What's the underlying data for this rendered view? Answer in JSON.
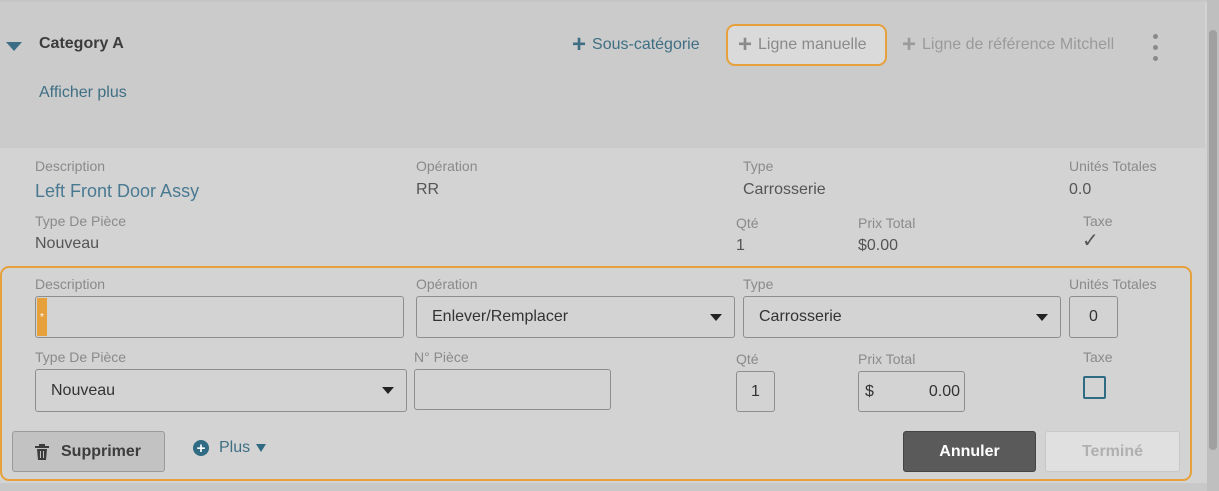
{
  "category": {
    "title": "Category A",
    "show_more": "Afficher plus",
    "actions": {
      "subcategory": "Sous-catégorie",
      "manual_line": "Ligne manuelle",
      "mitchell_line": "Ligne de référence Mitchell"
    }
  },
  "item": {
    "labels": {
      "description": "Description",
      "operation": "Opération",
      "type": "Type",
      "total_units": "Unités Totales",
      "part_type": "Type De Pièce",
      "qty": "Qté",
      "total_price": "Prix Total",
      "tax": "Taxe"
    },
    "values": {
      "description": "Left Front Door Assy",
      "operation": "RR",
      "type": "Carrosserie",
      "total_units": "0.0",
      "part_type": "Nouveau",
      "qty": "1",
      "total_price": "$0.00"
    }
  },
  "form": {
    "labels": {
      "description": "Description",
      "operation": "Opération",
      "type": "Type",
      "total_units": "Unités Totales",
      "part_type": "Type De Pièce",
      "part_number": "N° Pièce",
      "qty": "Qté",
      "total_price": "Prix Total",
      "tax": "Taxe"
    },
    "values": {
      "description": "",
      "operation": "Enlever/Remplacer",
      "type": "Carrosserie",
      "total_units": "0",
      "part_type": "Nouveau",
      "part_number": "",
      "qty": "1",
      "currency": "$",
      "total_price": "0.00",
      "tax_checked": false
    },
    "required_marker": "*",
    "buttons": {
      "delete": "Supprimer",
      "more": "Plus",
      "cancel": "Annuler",
      "done": "Terminé"
    }
  },
  "colors": {
    "accent": "#e6a13c",
    "link": "#3f6f84",
    "cancel_bg": "#5a5a5a"
  }
}
